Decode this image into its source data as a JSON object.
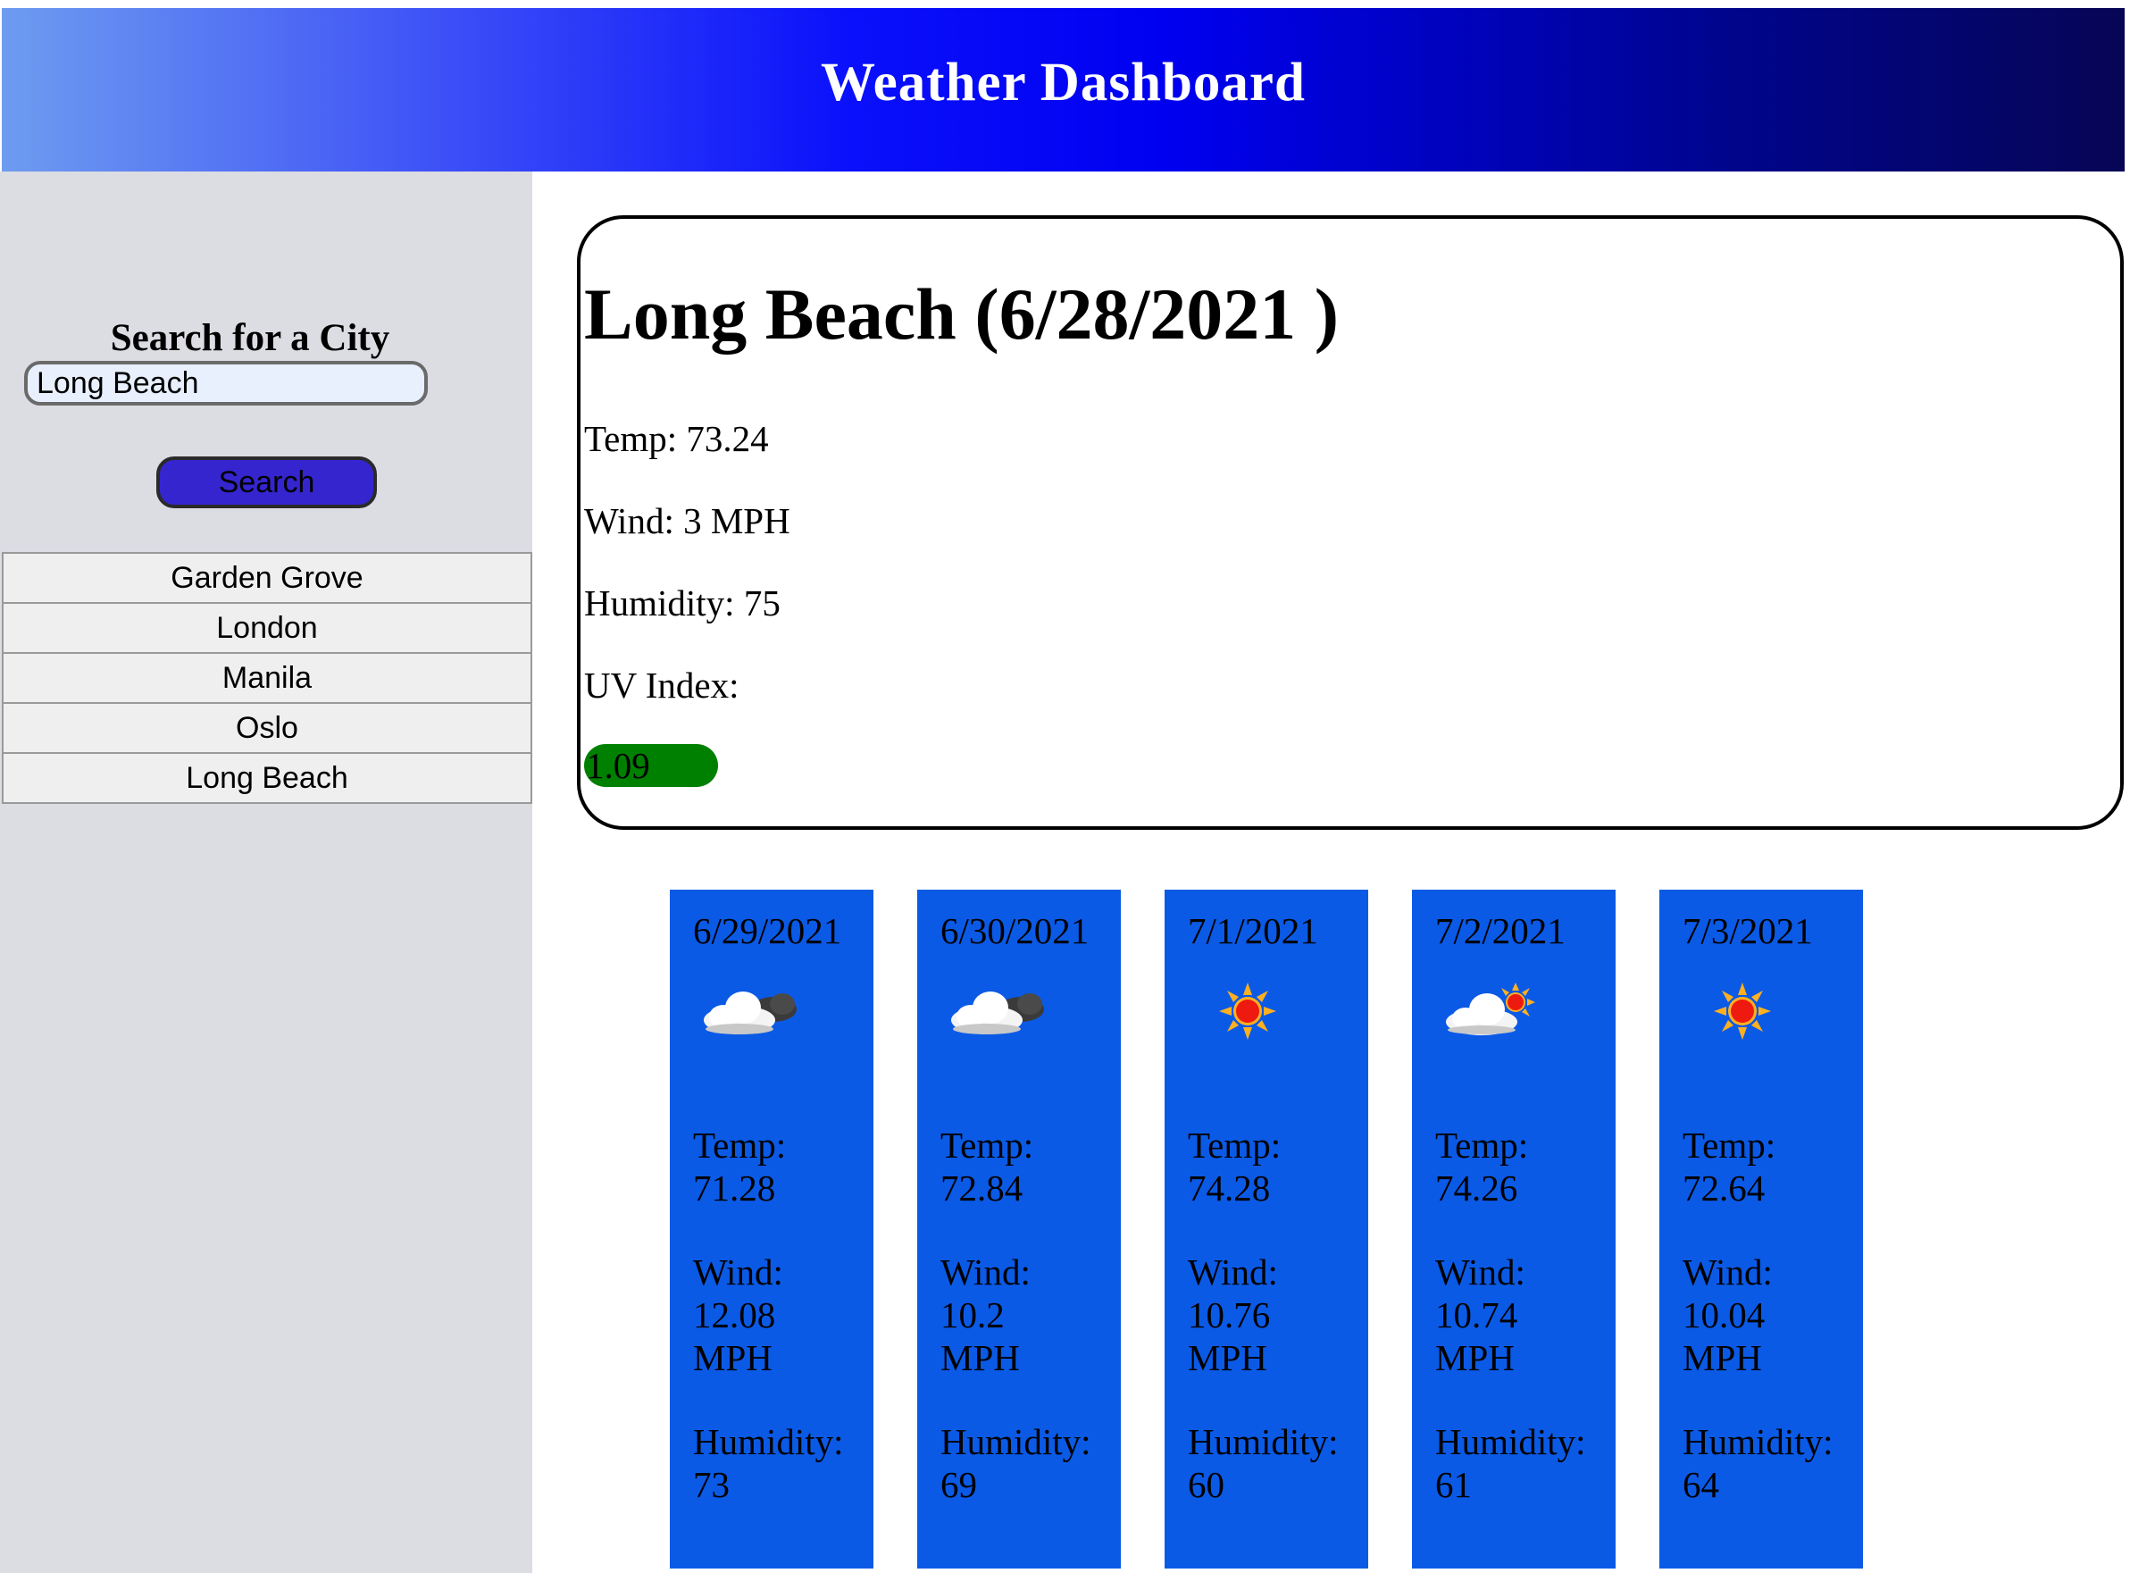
{
  "header": {
    "title": "Weather Dashboard"
  },
  "sidebar": {
    "search_label": "Search for a City",
    "search_value": "Long Beach",
    "search_button": "Search",
    "history": [
      "Garden Grove",
      "London",
      "Manila",
      "Oslo",
      "Long Beach"
    ]
  },
  "current": {
    "heading": "Long Beach (6/28/2021 )",
    "temp": "Temp: 73.24",
    "wind": "Wind: 3 MPH",
    "humidity": "Humidity: 75",
    "uv_label": "UV Index:",
    "uv_value": "1.09",
    "uv_color": "#008000"
  },
  "forecast": [
    {
      "date": "6/29/2021",
      "icon": "cloudy-icon",
      "temp_label": "Temp:",
      "temp": "71.28",
      "wind_label": "Wind:",
      "wind": "12.08",
      "wind_unit": "MPH",
      "humidity_label": "Humidity:",
      "humidity": "73"
    },
    {
      "date": "6/30/2021",
      "icon": "cloudy-icon",
      "temp_label": "Temp:",
      "temp": "72.84",
      "wind_label": "Wind:",
      "wind": "10.2",
      "wind_unit": "MPH",
      "humidity_label": "Humidity:",
      "humidity": "69"
    },
    {
      "date": "7/1/2021",
      "icon": "sun-icon",
      "temp_label": "Temp:",
      "temp": "74.28",
      "wind_label": "Wind:",
      "wind": "10.76",
      "wind_unit": "MPH",
      "humidity_label": "Humidity:",
      "humidity": "60"
    },
    {
      "date": "7/2/2021",
      "icon": "partly-cloudy-icon",
      "temp_label": "Temp:",
      "temp": "74.26",
      "wind_label": "Wind:",
      "wind": "10.74",
      "wind_unit": "MPH",
      "humidity_label": "Humidity:",
      "humidity": "61"
    },
    {
      "date": "7/3/2021",
      "icon": "sun-icon",
      "temp_label": "Temp:",
      "temp": "72.64",
      "wind_label": "Wind:",
      "wind": "10.04",
      "wind_unit": "MPH",
      "humidity_label": "Humidity:",
      "humidity": "64"
    }
  ],
  "colors": {
    "card_bg": "#0b5ae6",
    "search_button_bg": "#3525cf",
    "sidebar_bg": "#dcdce3"
  }
}
